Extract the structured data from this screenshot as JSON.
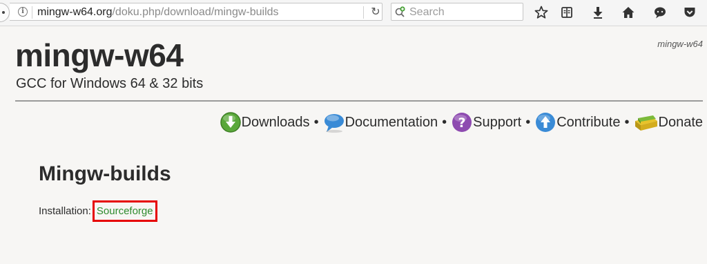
{
  "browser": {
    "url_domain": "mingw-w64.org",
    "url_path": "/doku.php/download/mingw-builds",
    "search_placeholder": "Search",
    "icons": [
      "info-icon",
      "reload-icon",
      "search-icon",
      "bookmark-star-icon",
      "reader-view-icon",
      "downloads-icon",
      "home-icon",
      "chat-icon",
      "pocket-icon"
    ]
  },
  "site": {
    "title": "mingw-w64",
    "tagline": "GCC for Windows 64 & 32 bits",
    "breadcrumb": "mingw-w64"
  },
  "nav": {
    "separator": "•",
    "items": [
      {
        "label": "Downloads",
        "icon": "downloads-icon",
        "color": "#5aa83a"
      },
      {
        "label": "Documentation",
        "icon": "speech-bubble-icon",
        "color": "#3a8bd6"
      },
      {
        "label": "Support",
        "icon": "question-icon",
        "color": "#8e4bb0"
      },
      {
        "label": "Contribute",
        "icon": "upload-icon",
        "color": "#3a8bd6"
      },
      {
        "label": "Donate",
        "icon": "money-icon",
        "color": "#6a9a28"
      }
    ]
  },
  "main": {
    "heading": "Mingw-builds",
    "install_label": "Installation:",
    "install_link": "Sourceforge",
    "link_color": "#2e8b2e",
    "highlight_color": "#e60000"
  }
}
